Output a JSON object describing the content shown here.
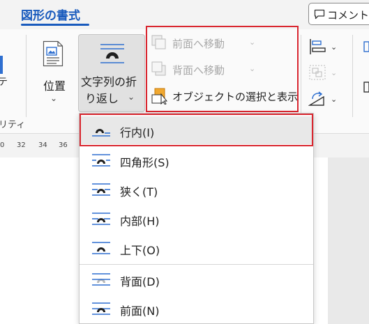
{
  "tabs": {
    "active_label": "図形の書式",
    "comment_label": "コメント"
  },
  "ribbon": {
    "left_fragment_text": "テ",
    "left_group_label": "リティ",
    "position": {
      "label": "位置"
    },
    "wrap_text": {
      "line1": "文字列の折",
      "line2": "り返し"
    },
    "arrange": {
      "bring_forward": "前面へ移動",
      "send_backward": "背面へ移動",
      "selection_pane": "オブジェクトの選択と表示"
    }
  },
  "ruler": {
    "ticks": [
      "0",
      "32",
      "34",
      "36"
    ]
  },
  "wrap_menu": {
    "items": [
      {
        "label": "行内(I)",
        "icon": "inline-wrap-icon"
      },
      {
        "label": "四角形(S)",
        "icon": "square-wrap-icon"
      },
      {
        "label": "狭く(T)",
        "icon": "tight-wrap-icon"
      },
      {
        "label": "内部(H)",
        "icon": "through-wrap-icon"
      },
      {
        "label": "上下(O)",
        "icon": "top-bottom-wrap-icon"
      },
      {
        "label": "背面(D)",
        "icon": "behind-text-icon"
      },
      {
        "label": "前面(N)",
        "icon": "in-front-of-text-icon"
      }
    ]
  },
  "colors": {
    "accent": "#185abd",
    "highlight_red": "#d9262f",
    "wrap_icon_blue": "#2e6fd0"
  }
}
